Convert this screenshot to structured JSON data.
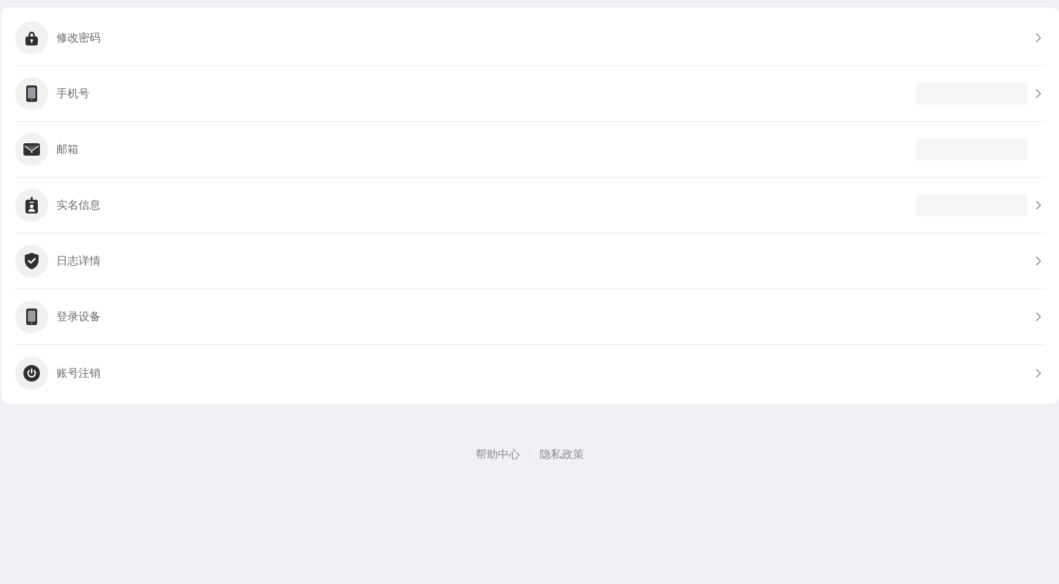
{
  "settings_list": [
    {
      "label": "修改密码",
      "value_hidden": false,
      "chevron": true
    },
    {
      "label": "手机号",
      "value_hidden": true,
      "chevron": true
    },
    {
      "label": "邮箱",
      "value_hidden": true,
      "chevron": false
    },
    {
      "label": "实名信息",
      "value_hidden": true,
      "chevron": true
    },
    {
      "label": "日志详情",
      "value_hidden": false,
      "chevron": true
    },
    {
      "label": "登录设备",
      "value_hidden": false,
      "chevron": true
    },
    {
      "label": "账号注销",
      "value_hidden": false,
      "chevron": true
    }
  ],
  "footer_links": [
    {
      "label": "帮助中心"
    },
    {
      "label": "隐私政策"
    }
  ]
}
